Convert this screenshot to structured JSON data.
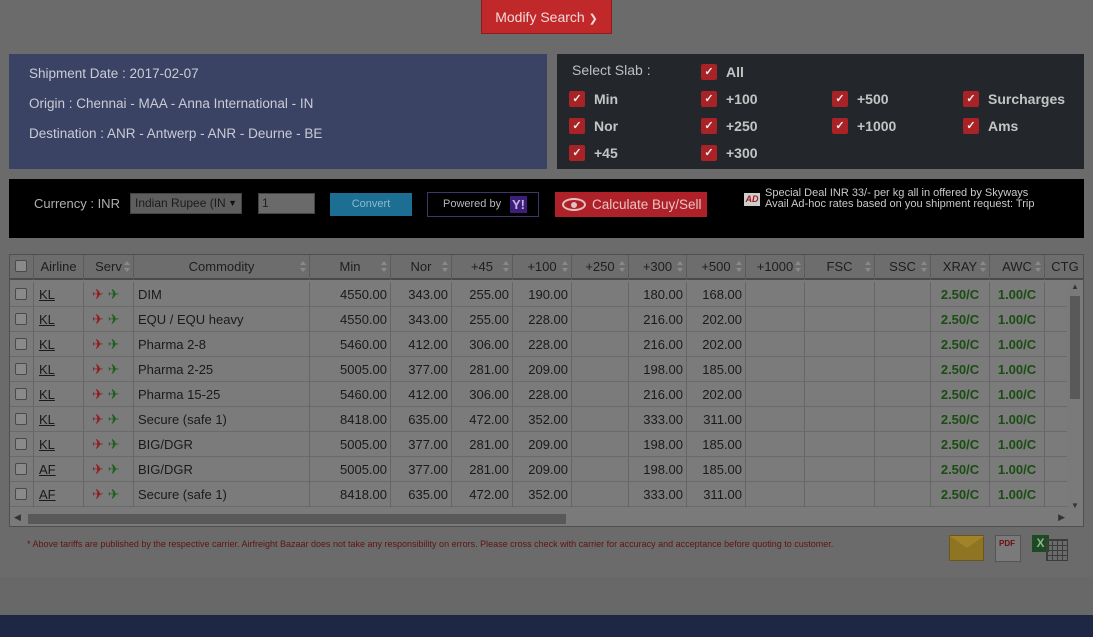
{
  "modify": {
    "label": "Modify Search",
    "icon": "chevron-down-icon"
  },
  "info": {
    "shipment_date": "Shipment Date : 2017-02-07",
    "origin": "Origin : Chennai - MAA - Anna International - IN",
    "destination": "Destination : ANR - Antwerp - ANR - Deurne - BE"
  },
  "slab": {
    "title": "Select Slab :",
    "options": [
      "All",
      "Min",
      "+100",
      "+500",
      "Surcharges",
      "Nor",
      "+250",
      "+1000",
      "Ams",
      "+45",
      "+300"
    ],
    "checked": true
  },
  "currency": {
    "label": "Currency : INR",
    "selected": "Indian Rupee (IN",
    "amount": "1",
    "convert_label": "Convert",
    "powered_by": "Powered by",
    "calc_label": "Calculate Buy/Sell",
    "deal_icon_text": "AD",
    "deal_line1": "Special Deal INR 33/- per kg all in offered by Skyways",
    "deal_line2": "Avail Ad-hoc rates based on you shipment request: Trip"
  },
  "table": {
    "columns": [
      "Airline",
      "Serv",
      "Commodity",
      "Min",
      "Nor",
      "+45",
      "+100",
      "+250",
      "+300",
      "+500",
      "+1000",
      "FSC",
      "SSC",
      "XRAY",
      "AWC",
      "CTG"
    ],
    "rows": [
      {
        "airline": "KL",
        "commodity": "DIM",
        "min": "4550.00",
        "nor": "343.00",
        "p45": "255.00",
        "p100": "190.00",
        "p250": "",
        "p300": "180.00",
        "p500": "168.00",
        "p1000": "",
        "fsc": "",
        "ssc": "",
        "xray": "2.50/C",
        "awc": "1.00/C"
      },
      {
        "airline": "KL",
        "commodity": "EQU / EQU heavy",
        "min": "4550.00",
        "nor": "343.00",
        "p45": "255.00",
        "p100": "228.00",
        "p250": "",
        "p300": "216.00",
        "p500": "202.00",
        "p1000": "",
        "fsc": "",
        "ssc": "",
        "xray": "2.50/C",
        "awc": "1.00/C"
      },
      {
        "airline": "KL",
        "commodity": "Pharma 2-8",
        "min": "5460.00",
        "nor": "412.00",
        "p45": "306.00",
        "p100": "228.00",
        "p250": "",
        "p300": "216.00",
        "p500": "202.00",
        "p1000": "",
        "fsc": "",
        "ssc": "",
        "xray": "2.50/C",
        "awc": "1.00/C"
      },
      {
        "airline": "KL",
        "commodity": "Pharma 2-25",
        "min": "5005.00",
        "nor": "377.00",
        "p45": "281.00",
        "p100": "209.00",
        "p250": "",
        "p300": "198.00",
        "p500": "185.00",
        "p1000": "",
        "fsc": "",
        "ssc": "",
        "xray": "2.50/C",
        "awc": "1.00/C"
      },
      {
        "airline": "KL",
        "commodity": "Pharma 15-25",
        "min": "5460.00",
        "nor": "412.00",
        "p45": "306.00",
        "p100": "228.00",
        "p250": "",
        "p300": "216.00",
        "p500": "202.00",
        "p1000": "",
        "fsc": "",
        "ssc": "",
        "xray": "2.50/C",
        "awc": "1.00/C"
      },
      {
        "airline": "KL",
        "commodity": "Secure (safe 1)",
        "min": "8418.00",
        "nor": "635.00",
        "p45": "472.00",
        "p100": "352.00",
        "p250": "",
        "p300": "333.00",
        "p500": "311.00",
        "p1000": "",
        "fsc": "",
        "ssc": "",
        "xray": "2.50/C",
        "awc": "1.00/C"
      },
      {
        "airline": "KL",
        "commodity": "BIG/DGR",
        "min": "5005.00",
        "nor": "377.00",
        "p45": "281.00",
        "p100": "209.00",
        "p250": "",
        "p300": "198.00",
        "p500": "185.00",
        "p1000": "",
        "fsc": "",
        "ssc": "",
        "xray": "2.50/C",
        "awc": "1.00/C"
      },
      {
        "airline": "AF",
        "commodity": "BIG/DGR",
        "min": "5005.00",
        "nor": "377.00",
        "p45": "281.00",
        "p100": "209.00",
        "p250": "",
        "p300": "198.00",
        "p500": "185.00",
        "p1000": "",
        "fsc": "",
        "ssc": "",
        "xray": "2.50/C",
        "awc": "1.00/C"
      },
      {
        "airline": "AF",
        "commodity": "Secure (safe 1)",
        "min": "8418.00",
        "nor": "635.00",
        "p45": "472.00",
        "p100": "352.00",
        "p250": "",
        "p300": "333.00",
        "p500": "311.00",
        "p1000": "",
        "fsc": "",
        "ssc": "",
        "xray": "2.50/C",
        "awc": "1.00/C"
      }
    ]
  },
  "footer": {
    "disclaimer": "* Above tariffs are published by the respective carrier. Airfreight Bazaar does not take any responsibility on errors. Please cross check with carrier for accuracy and acceptance before quoting to customer.",
    "pdf_text": "PDF",
    "xls_text": "X"
  },
  "colors": {
    "accent_red": "#c0282a",
    "info_bg": "#3b4365",
    "slab_bg": "#23272c",
    "green_value": "#1a4d12"
  }
}
